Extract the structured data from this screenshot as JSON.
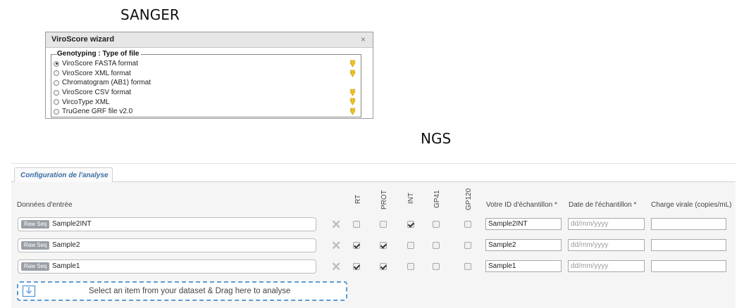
{
  "sanger": {
    "heading": "SANGER",
    "wizard": {
      "title": "ViroScore wizard",
      "close": "×",
      "legend": "Genotyping : Type of file",
      "options": [
        {
          "label": "ViroScore FASTA format",
          "selected": true,
          "icon": true
        },
        {
          "label": "ViroScore XML format",
          "selected": false,
          "icon": true
        },
        {
          "label": "Chromatogram (AB1) format",
          "selected": false,
          "icon": false
        },
        {
          "label": "ViroScore CSV format",
          "selected": false,
          "icon": true
        },
        {
          "label": "VircoType XML",
          "selected": false,
          "icon": true
        },
        {
          "label": "TruGene GRF file v2.0",
          "selected": false,
          "icon": true
        }
      ]
    }
  },
  "ngs": {
    "heading": "NGS",
    "tab": "Configuration de l'analyse",
    "input_label": "Données d'entrée",
    "columns": {
      "rt": "RT",
      "prot": "PROT",
      "int": "INT",
      "gp41": "GP41",
      "gp120": "GP120",
      "sample_id": "Votre ID d'échantillon *",
      "sample_date": "Date de l'échantillon *",
      "viral_load": "Charge virale (copies/mL)"
    },
    "rows": [
      {
        "badge": "Raw Seq",
        "name": "Sample2INT",
        "rt": false,
        "prot": false,
        "int": true,
        "gp41": false,
        "gp120": false,
        "id": "Sample2INT",
        "date_placeholder": "dd/mm/yyyy",
        "load": ""
      },
      {
        "badge": "Raw Seq",
        "name": "Sample2",
        "rt": true,
        "prot": true,
        "int": false,
        "gp41": false,
        "gp120": false,
        "id": "Sample2",
        "date_placeholder": "dd/mm/yyyy",
        "load": ""
      },
      {
        "badge": "Raw Seq",
        "name": "Sample1",
        "rt": true,
        "prot": true,
        "int": false,
        "gp41": false,
        "gp120": false,
        "id": "Sample1",
        "date_placeholder": "dd/mm/yyyy",
        "load": ""
      }
    ],
    "dropzone": "Select an item from your dataset & Drag here to analyse",
    "colors": {
      "tab_text": "#3a6ea5",
      "dropzone_border": "#5a9bd5",
      "badge_bg": "#9aa0a6"
    }
  }
}
